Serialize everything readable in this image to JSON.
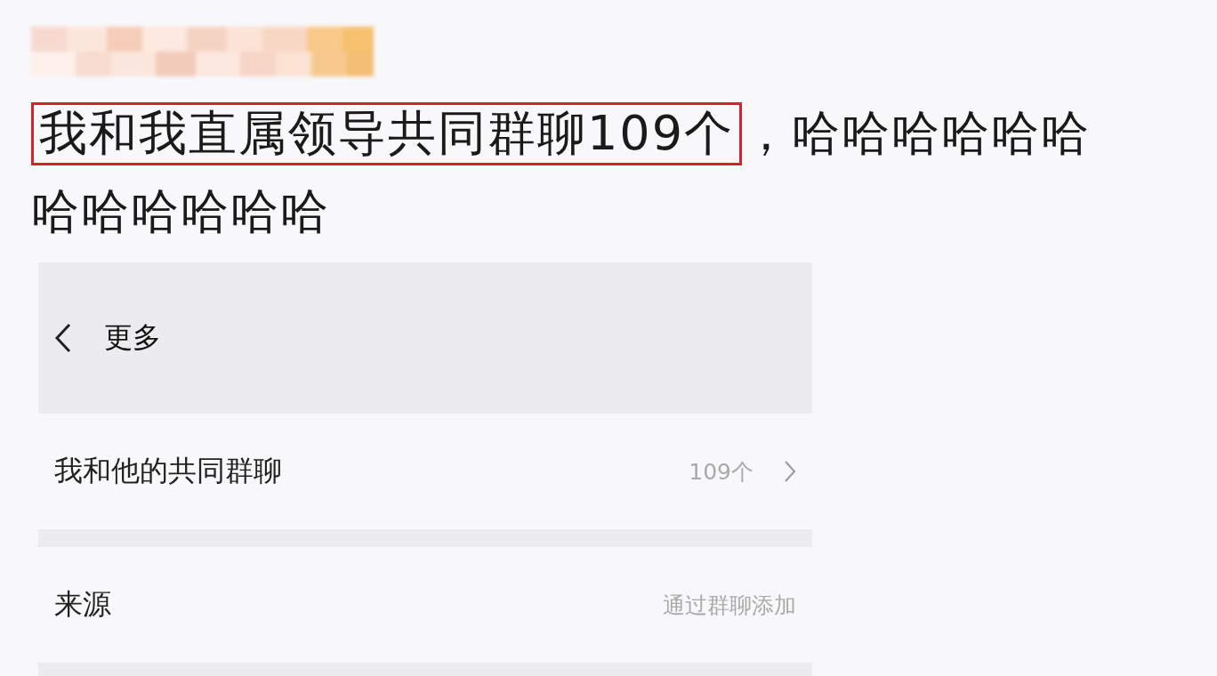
{
  "post": {
    "highlighted_text": "我和我直属领导共同群聊109个",
    "rest_lines": [
      "，哈哈哈哈哈哈",
      "哈哈哈哈哈哈"
    ]
  },
  "card": {
    "title": "更多",
    "rows": [
      {
        "label": "我和他的共同群聊",
        "value": "109个",
        "kind": "link"
      },
      {
        "label": "来源",
        "value": "通过群聊添加",
        "kind": "info"
      }
    ]
  }
}
